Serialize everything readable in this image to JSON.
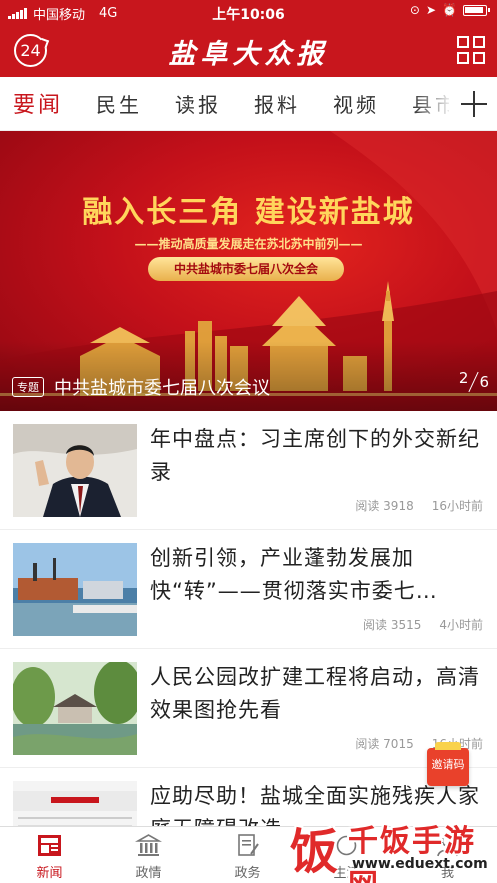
{
  "status_bar": {
    "carrier": "中国移动",
    "network": "4G",
    "time": "上午10:06"
  },
  "header": {
    "badge": "24",
    "app_title": "盐阜大众报",
    "brand_color": "#c8161d"
  },
  "tabs": [
    {
      "label": "要闻",
      "active": true
    },
    {
      "label": "民生",
      "active": false
    },
    {
      "label": "读报",
      "active": false
    },
    {
      "label": "报料",
      "active": false
    },
    {
      "label": "视频",
      "active": false
    },
    {
      "label": "县市",
      "active": false
    }
  ],
  "banner": {
    "headline": "融入长三角  建设新盐城",
    "subline": "推动高质量发展走在苏北苏中前列",
    "pill": "中共盐城市委七届八次全会",
    "tag": "专题",
    "caption": "中共盐城市委七届八次会议",
    "page_current": "2",
    "page_total": "6"
  },
  "news": [
    {
      "title": "年中盘点：习主席创下的外交新纪录",
      "reads": "阅读 3918",
      "time": "16小时前"
    },
    {
      "title": "创新引领，产业蓬勃发展加快“转”——贯彻落实市委七…",
      "reads": "阅读 3515",
      "time": "4小时前"
    },
    {
      "title": "人民公园改扩建工程将启动，高清效果图抢先看",
      "reads": "阅读 7015",
      "time": "16小时前"
    },
    {
      "title": "应助尽助！盐城全面实施残疾人家庭无障碍改造",
      "reads": "",
      "time": ""
    }
  ],
  "invite_button": "邀请码",
  "bottom_nav": [
    {
      "label": "新闻",
      "icon": "newspaper-icon",
      "active": true
    },
    {
      "label": "政情",
      "icon": "building-icon",
      "active": false
    },
    {
      "label": "政务",
      "icon": "document-icon",
      "active": false
    },
    {
      "label": "生活",
      "icon": "life-icon",
      "active": false
    },
    {
      "label": "我",
      "icon": "user-icon",
      "active": false
    }
  ],
  "watermark": {
    "glyph": "饭",
    "name": "千饭手游网",
    "url": "www.eduext.com"
  }
}
